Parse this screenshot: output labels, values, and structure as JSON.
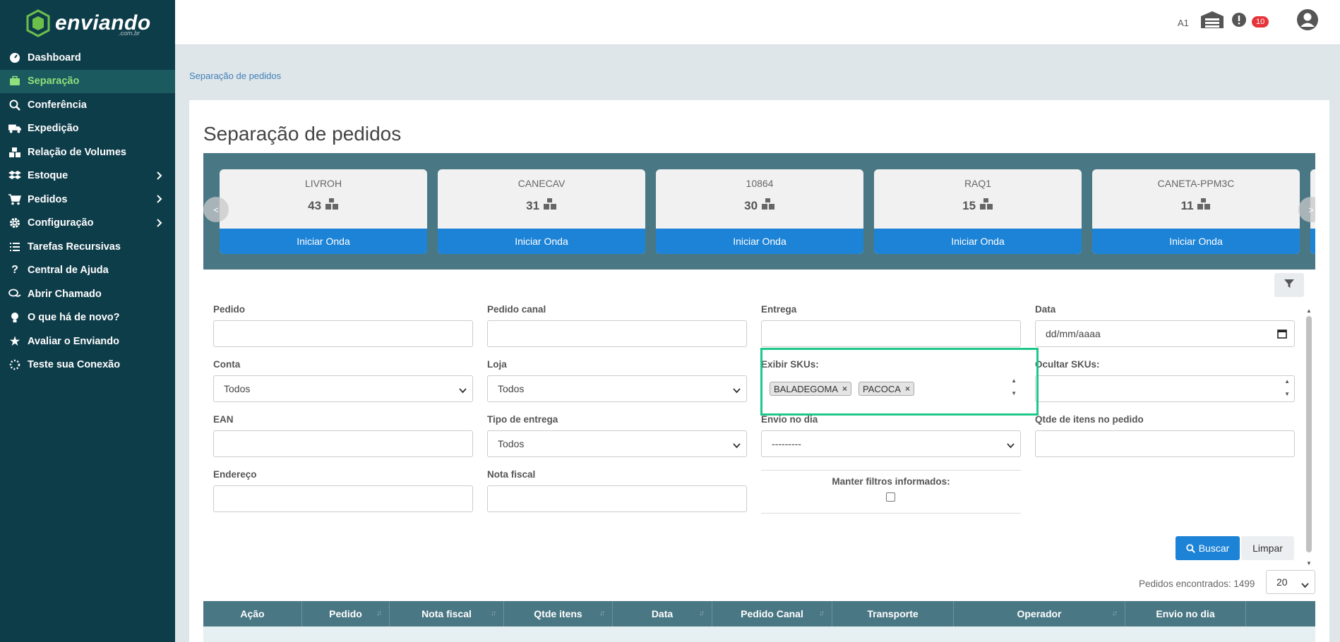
{
  "logo": {
    "text": "enviando",
    "sub": ".com.br"
  },
  "nav": [
    {
      "label": "Dashboard",
      "icon": "speedometer-icon"
    },
    {
      "label": "Separação",
      "icon": "briefcase-icon",
      "active": true
    },
    {
      "label": "Conferência",
      "icon": "search-icon"
    },
    {
      "label": "Expedição",
      "icon": "truck-icon"
    },
    {
      "label": "Relação de Volumes",
      "icon": "boxes-icon"
    },
    {
      "label": "Estoque",
      "icon": "dropbox-icon",
      "chevron": true
    },
    {
      "label": "Pedidos",
      "icon": "cart-icon",
      "chevron": true
    },
    {
      "label": "Configuração",
      "icon": "gear-icon",
      "chevron": true
    },
    {
      "label": "Tarefas Recursivas",
      "icon": "list-icon"
    },
    {
      "label": "Central de Ajuda",
      "icon": "question-icon"
    },
    {
      "label": "Abrir Chamado",
      "icon": "chat-icon"
    },
    {
      "label": "O que há de novo?",
      "icon": "lightbulb-icon"
    },
    {
      "label": "Avaliar o Enviando",
      "icon": "star-icon"
    },
    {
      "label": "Teste sua Conexão",
      "icon": "spinner-icon"
    }
  ],
  "topbar": {
    "account": "A1",
    "alerts": "10"
  },
  "breadcrumb": "Separação de pedidos",
  "title": "Separação de pedidos",
  "waves": [
    {
      "sku": "LIVROH",
      "qty": "43",
      "button": "Iniciar Onda"
    },
    {
      "sku": "CANECAV",
      "qty": "31",
      "button": "Iniciar Onda"
    },
    {
      "sku": "10864",
      "qty": "30",
      "button": "Iniciar Onda"
    },
    {
      "sku": "RAQ1",
      "qty": "15",
      "button": "Iniciar Onda"
    },
    {
      "sku": "CANETA-PPM3C",
      "qty": "11",
      "button": "Iniciar Onda"
    }
  ],
  "carousel": {
    "prev": "<",
    "next": ">"
  },
  "filters": {
    "pedido": {
      "label": "Pedido",
      "value": ""
    },
    "pedido_canal": {
      "label": "Pedido canal",
      "value": ""
    },
    "entrega": {
      "label": "Entrega",
      "value": ""
    },
    "data": {
      "label": "Data",
      "placeholder": "dd/mm/aaaa"
    },
    "conta": {
      "label": "Conta",
      "value": "Todos"
    },
    "loja": {
      "label": "Loja",
      "value": "Todos"
    },
    "exibir_skus": {
      "label": "Exibir SKUs:",
      "tags": [
        "BALADEGOMA",
        "PACOCA"
      ]
    },
    "ocultar_skus": {
      "label": "Ocultar SKUs:",
      "value": ""
    },
    "ean": {
      "label": "EAN",
      "value": ""
    },
    "tipo_entrega": {
      "label": "Tipo de entrega",
      "value": "Todos"
    },
    "envio_dia": {
      "label": "Envio no dia",
      "value": "---------"
    },
    "qtde_itens": {
      "label": "Qtde de itens no pedido",
      "value": ""
    },
    "endereco": {
      "label": "Endereço",
      "value": ""
    },
    "nota_fiscal": {
      "label": "Nota fiscal",
      "value": ""
    },
    "manter": {
      "label": "Manter filtros informados:",
      "checked": false
    }
  },
  "buttons": {
    "search": "Buscar",
    "clear": "Limpar"
  },
  "results": {
    "found_label": "Pedidos encontrados: 1499",
    "page_size": "20"
  },
  "table": {
    "columns": [
      {
        "label": "Ação",
        "sortable": false
      },
      {
        "label": "Pedido",
        "sortable": true
      },
      {
        "label": "Nota fiscal",
        "sortable": true
      },
      {
        "label": "Qtde itens",
        "sortable": true
      },
      {
        "label": "Data",
        "sortable": true
      },
      {
        "label": "Pedido Canal",
        "sortable": true
      },
      {
        "label": "Transporte",
        "sortable": false
      },
      {
        "label": "Operador",
        "sortable": true
      },
      {
        "label": "Envio no dia",
        "sortable": false
      },
      {
        "label": "",
        "sortable": false
      }
    ]
  },
  "colors": {
    "sidebar": "#0e3d4a",
    "accent": "#1d83d7",
    "highlight": "#1ec88a",
    "active_text": "#8ee07c",
    "table_head": "#4a7784"
  }
}
